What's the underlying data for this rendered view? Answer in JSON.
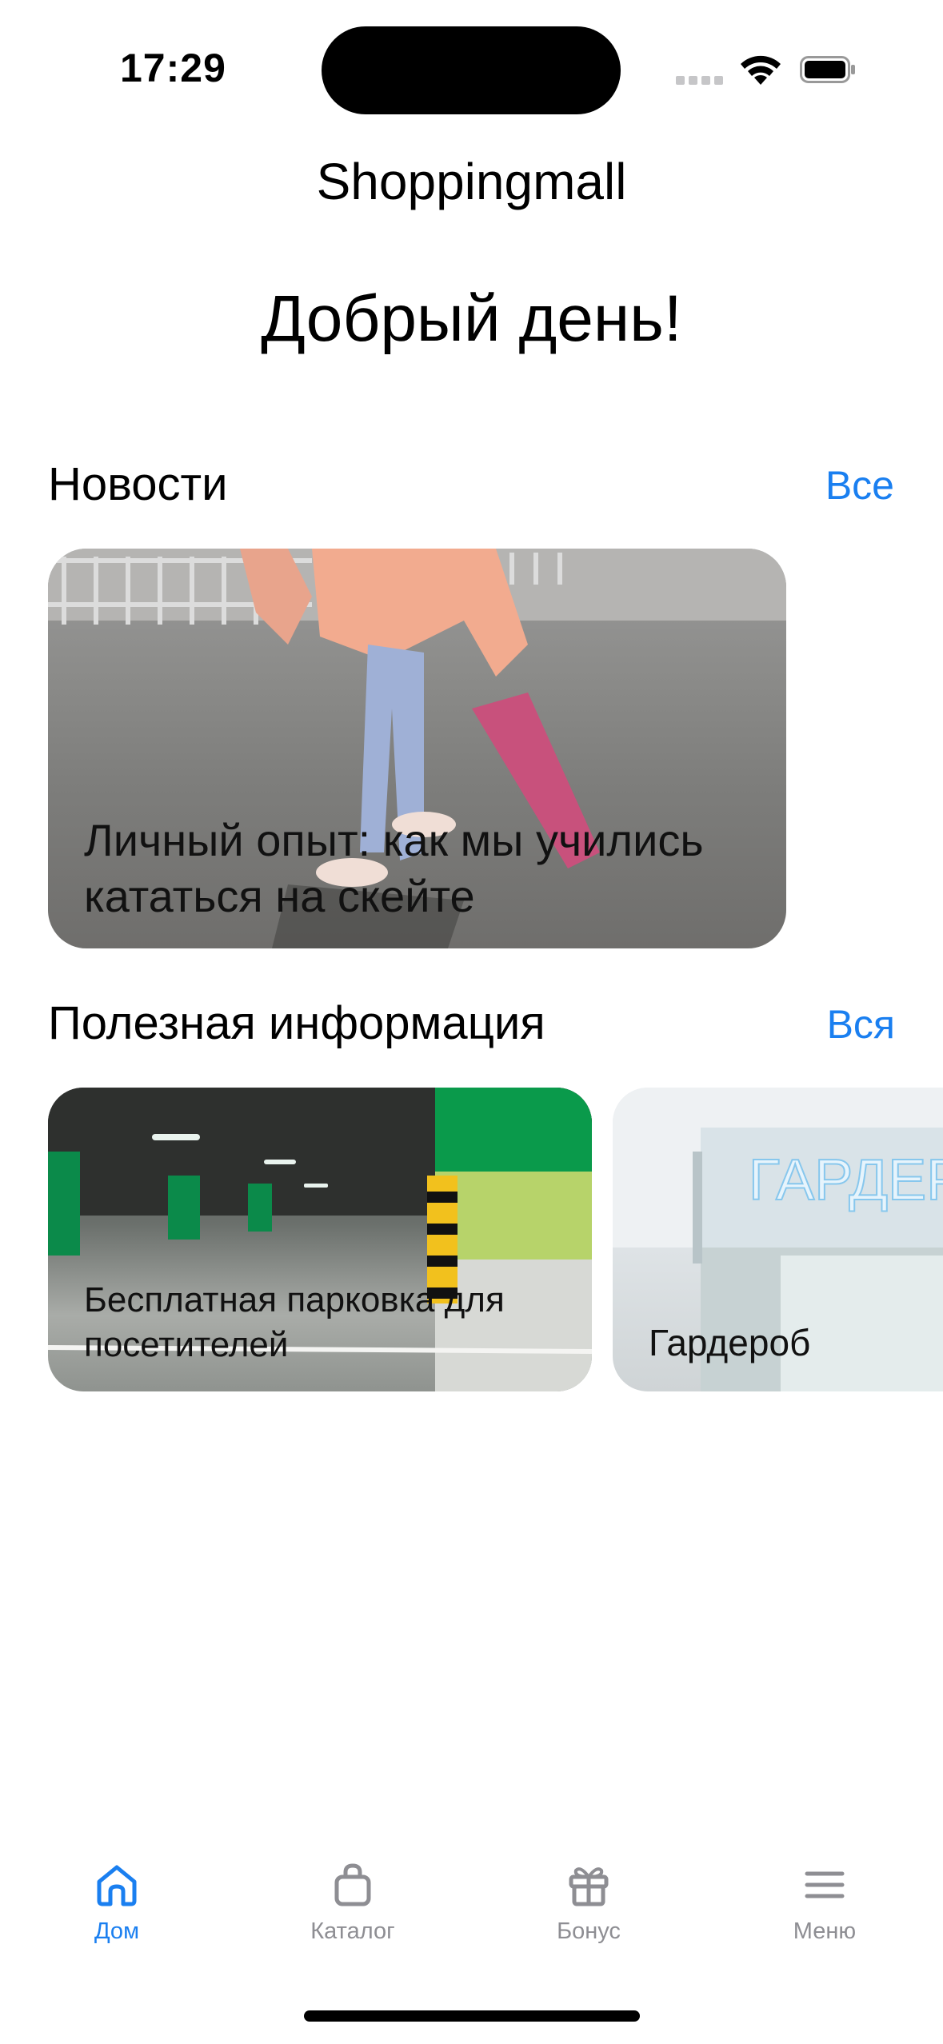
{
  "status_bar": {
    "time": "17:29"
  },
  "app_title": "Shoppingmall",
  "greeting": "Добрый день!",
  "news": {
    "title": "Новости",
    "see_all": "Все",
    "items": [
      {
        "title": "Личный опыт: как мы учились кататься на скейте"
      }
    ]
  },
  "useful_info": {
    "title": "Полезная информация",
    "see_all": "Вся",
    "items": [
      {
        "title": "Бесплатная парковка для посетителей"
      },
      {
        "title": "Гардероб"
      }
    ]
  },
  "tab_bar": {
    "accent": "#1a7ff0",
    "items": [
      {
        "label": "Дом",
        "icon": "home-icon",
        "active": true
      },
      {
        "label": "Каталог",
        "icon": "bag-icon",
        "active": false
      },
      {
        "label": "Бонус",
        "icon": "gift-icon",
        "active": false
      },
      {
        "label": "Меню",
        "icon": "menu-icon",
        "active": false
      }
    ]
  }
}
